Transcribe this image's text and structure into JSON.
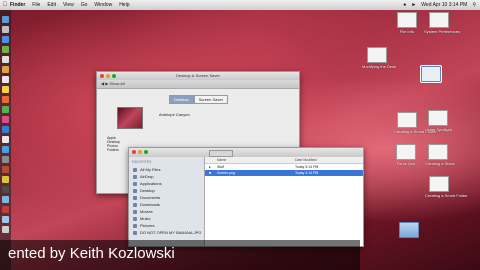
{
  "menubar": {
    "items": [
      "Finder",
      "File",
      "Edit",
      "View",
      "Go",
      "Window",
      "Help"
    ],
    "clock": "Wed Apr 10 3:14 PM"
  },
  "desktop_icons": [
    {
      "label": "File Info"
    },
    {
      "label": "System Preferences"
    },
    {
      "label": "Modifying the Desk"
    },
    {
      "label": ""
    },
    {
      "label": "Creating a Smart Folder"
    },
    {
      "label": "Using Spotlight"
    },
    {
      "label": "Force Quit"
    },
    {
      "label": "Creating a Stack"
    },
    {
      "label": "Creating a Smart Folder"
    }
  ],
  "desktop_prefs": {
    "title": "Desktop & Screen Saver",
    "toolbar_label": "Show All",
    "tabs": [
      "Desktop",
      "Screen Saver"
    ],
    "selected_tab": "Desktop",
    "wallpaper_name": "Antelope Canyon",
    "sidebar_items": [
      "Apple",
      "Desktop",
      "Photos",
      "Folders"
    ]
  },
  "finder": {
    "sidebar_header": "FAVORITES",
    "sidebar_items": [
      "All My Files",
      "AirDrop",
      "Applications",
      "Desktop",
      "Documents",
      "Downloads",
      "Movies",
      "Music",
      "Pictures",
      "DO NOT OPEN MY BANANA.JPG"
    ],
    "columns": [
      "Name",
      "Date Modified"
    ],
    "rows": [
      {
        "name": "Stuff",
        "date": "Today 3:14 PM",
        "selected": false
      },
      {
        "name": "Screen.png",
        "date": "Today 3:14 PM",
        "selected": true
      }
    ]
  },
  "caption": "ented by Keith Kozlowski",
  "colors": {
    "selection": "#3875d7",
    "tab_selected": "#8aa0bd"
  }
}
